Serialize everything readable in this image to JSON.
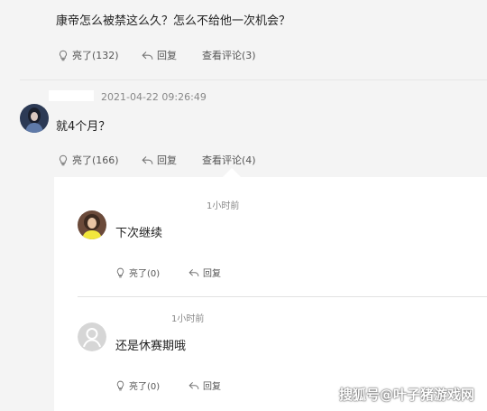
{
  "comment1": {
    "text": "康帝怎么被禁这么久？怎么不给他一次机会？",
    "like_label": "亮了(132)",
    "reply_label": "回复",
    "view_label": "查看评论(3)"
  },
  "comment2": {
    "timestamp": "2021-04-22 09:26:49",
    "text": "就4个月？",
    "like_label": "亮了(166)",
    "reply_label": "回复",
    "view_label": "查看评论(4)"
  },
  "replies": [
    {
      "time": "1小时前",
      "text": "下次继续",
      "like_label": "亮了(0)",
      "reply_label": "回复"
    },
    {
      "time": "1小时前",
      "text": "还是休赛期哦",
      "like_label": "亮了(0)",
      "reply_label": "回复"
    }
  ],
  "watermark": "搜狐号@叶子猪游戏网",
  "icons": {
    "like": "lightbulb-icon",
    "reply": "reply-arrow-icon"
  },
  "colors": {
    "page_bg": "#f4f4f4",
    "panel_bg": "#ffffff",
    "secondary_text": "#888888"
  }
}
